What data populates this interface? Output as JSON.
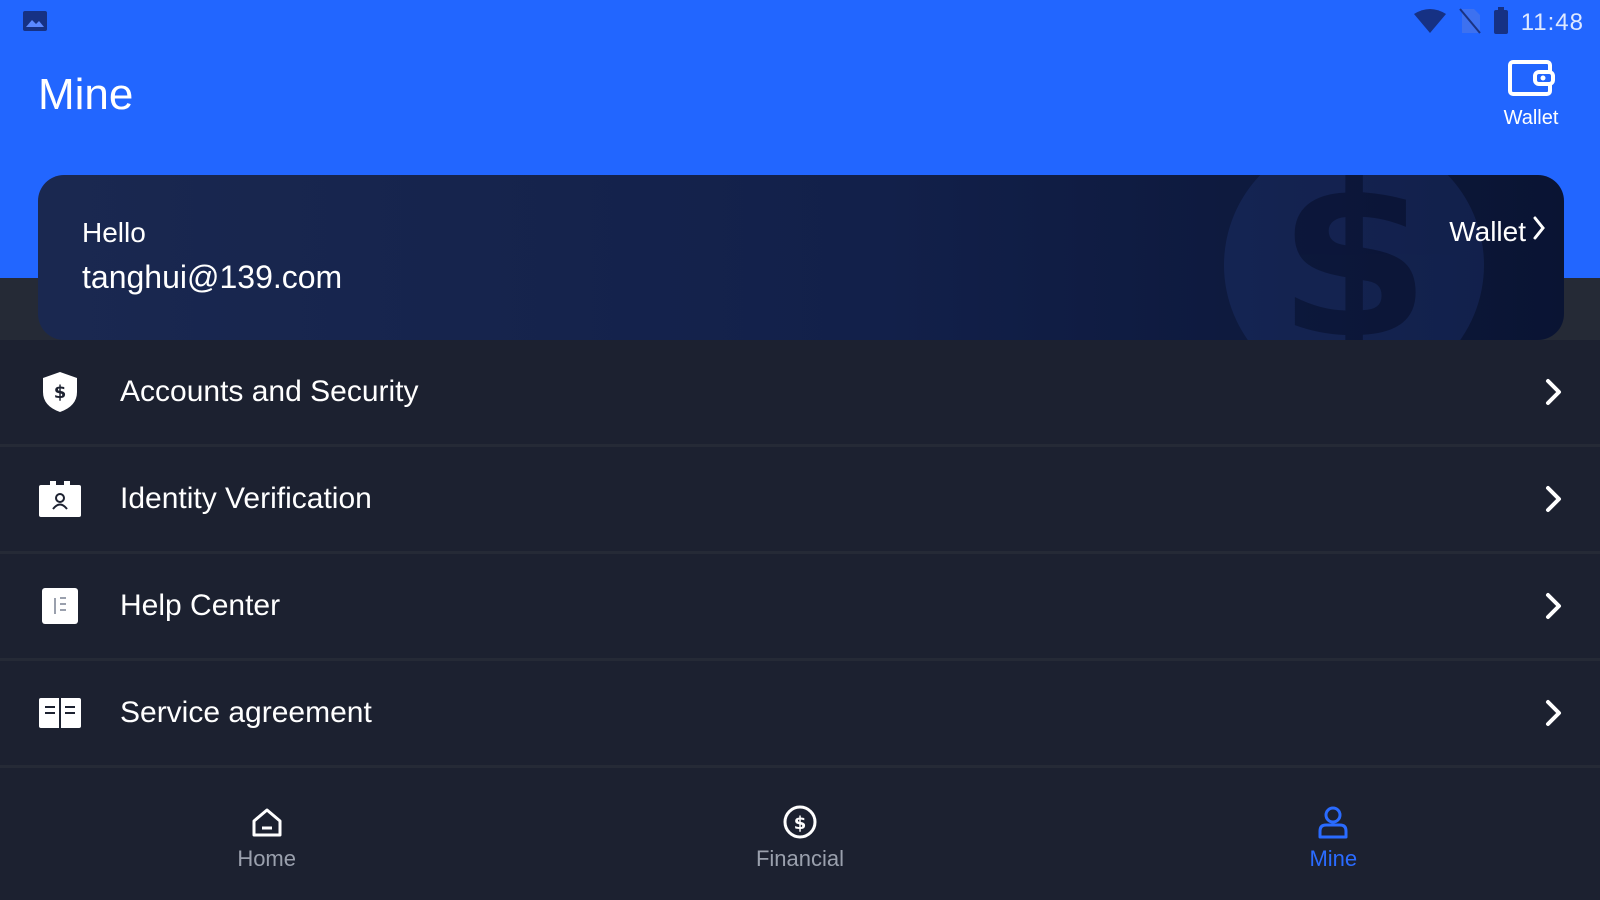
{
  "status_bar": {
    "time": "11:48",
    "icons": [
      "gallery-icon",
      "wifi-icon",
      "no-sim-icon",
      "battery-icon"
    ]
  },
  "header": {
    "title": "Mine",
    "wallet_label": "Wallet"
  },
  "card": {
    "greeting": "Hello",
    "email": "tanghui@139.com",
    "wallet_link": "Wallet"
  },
  "menu": {
    "items": [
      {
        "label": "Accounts and Security",
        "icon": "shield-dollar-icon"
      },
      {
        "label": "Identity Verification",
        "icon": "id-card-icon"
      },
      {
        "label": "Help Center",
        "icon": "document-list-icon"
      },
      {
        "label": "Service agreement",
        "icon": "open-book-icon"
      }
    ]
  },
  "bottom_nav": {
    "items": [
      {
        "label": "Home",
        "icon": "home-icon",
        "active": false
      },
      {
        "label": "Financial",
        "icon": "dollar-circle-icon",
        "active": false
      },
      {
        "label": "Mine",
        "icon": "person-icon",
        "active": true
      }
    ]
  },
  "colors": {
    "header_blue": "#2266ff",
    "background": "#1c2130",
    "active_accent": "#2a6bff"
  }
}
